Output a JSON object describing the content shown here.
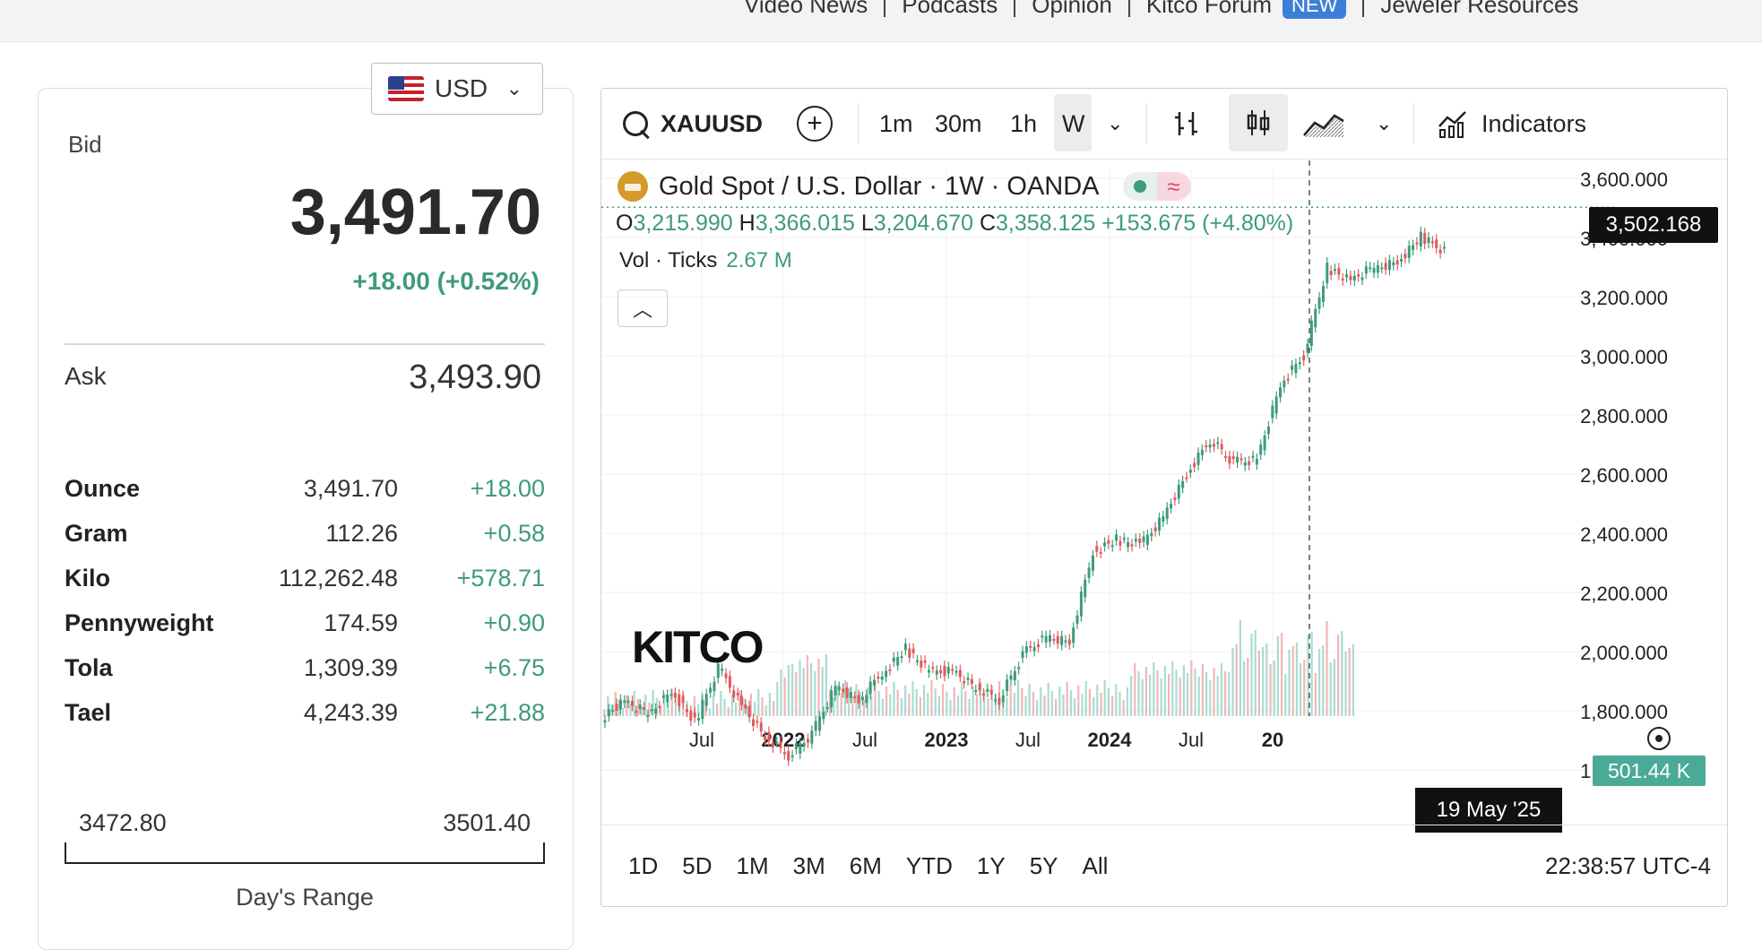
{
  "topnav": {
    "items": [
      "Video News",
      "Podcasts",
      "Opinion",
      "Kitco Forum",
      "Jeweler Resources"
    ],
    "new_badge": "NEW"
  },
  "quote": {
    "currency": "USD",
    "bid_label": "Bid",
    "bid": "3,491.70",
    "change": "+18.00 (+0.52%)",
    "ask_label": "Ask",
    "ask": "3,493.90",
    "units": [
      {
        "name": "Ounce",
        "value": "3,491.70",
        "change": "+18.00"
      },
      {
        "name": "Gram",
        "value": "112.26",
        "change": "+0.58"
      },
      {
        "name": "Kilo",
        "value": "112,262.48",
        "change": "+578.71"
      },
      {
        "name": "Pennyweight",
        "value": "174.59",
        "change": "+0.90"
      },
      {
        "name": "Tola",
        "value": "1,309.39",
        "change": "+6.75"
      },
      {
        "name": "Tael",
        "value": "4,243.39",
        "change": "+21.88"
      }
    ],
    "range_low": "3472.80",
    "range_high": "3501.40",
    "range_label": "Day's Range"
  },
  "toolbar": {
    "symbol": "XAUUSD",
    "intervals": [
      "1m",
      "30m",
      "1h",
      "W"
    ],
    "indicators": "Indicators"
  },
  "legend": {
    "title": "Gold Spot / U.S. Dollar · 1W · OANDA",
    "o_label": "O",
    "o": "3,215.990",
    "h_label": "H",
    "h": "3,366.015",
    "l_label": "L",
    "l": "3,204.670",
    "c_label": "C",
    "c": "3,358.125",
    "chg": "+153.675 (+4.80%)",
    "vol_label": "Vol · Ticks",
    "vol": "2.67 M",
    "watermark": "KITCO"
  },
  "chart_data": {
    "type": "line",
    "title": "Gold Spot / U.S. Dollar · 1W · OANDA",
    "x_tick_labels": [
      "Jul",
      "2022",
      "Jul",
      "2023",
      "Jul",
      "2024",
      "Jul",
      "20"
    ],
    "y_tick_labels": [
      "3,600.000",
      "3,400.000",
      "3,200.000",
      "3,000.000",
      "2,800.000",
      "2,600.000",
      "2,400.000",
      "2,200.000",
      "2,000.000",
      "1,800.000",
      "1,600.000"
    ],
    "ylim": [
      1540,
      3630
    ],
    "series": [
      {
        "values": [
          1780,
          1830,
          1790,
          1870,
          1760,
          1950,
          1820,
          1710,
          1650,
          1720,
          1880,
          1830,
          1930,
          2010,
          1930,
          1940,
          1880,
          1840,
          1990,
          2050,
          2030,
          2340,
          2380,
          2360,
          2460,
          2600,
          2720,
          2640,
          2650,
          2900,
          3000,
          3300,
          3250,
          3300,
          3320,
          3400,
          3358
        ]
      }
    ],
    "last_price": "3,502.168",
    "last_volume": "501.44 K",
    "crosshair_date": "19 May '25"
  },
  "bottom": {
    "ranges": [
      "1D",
      "5D",
      "1M",
      "3M",
      "6M",
      "YTD",
      "1Y",
      "5Y",
      "All"
    ],
    "clock": "22:38:57 UTC-4"
  }
}
